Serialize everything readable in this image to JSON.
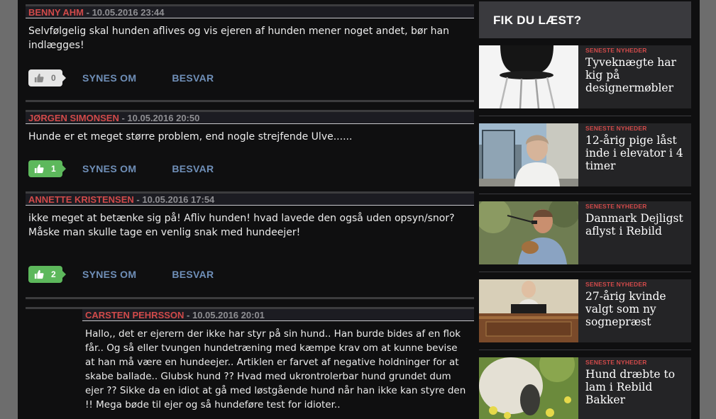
{
  "comments": [
    {
      "author": "Benny Ahm",
      "date": " - 10.05.2016 23:44",
      "text": "Selvfølgelig skal hunden aflives og vis ejeren af hunden mener noget andet, bør han indlægges!",
      "likes": "0",
      "like_label": "SYNES OM",
      "reply_label": "BESVAR"
    },
    {
      "author": "Jørgen Simonsen",
      "date": " - 10.05.2016 20:50",
      "text": "Hunde er et meget større problem, end nogle strejfende Ulve......",
      "likes": "1",
      "like_label": "SYNES OM",
      "reply_label": "BESVAR"
    },
    {
      "author": "Annette Kristensen",
      "date": " - 10.05.2016 17:54",
      "text": "ikke meget at betænke sig på! Afliv hunden! hvad lavede den også uden opsyn/snor? Måske man skulle tage en venlig snak med hundeejer!",
      "likes": "2",
      "like_label": "SYNES OM",
      "reply_label": "BESVAR"
    },
    {
      "author": "Carsten Pehrsson",
      "date": " - 10.05.2016 20:01",
      "text": "Hallo,, det er ejerern der ikke har styr på sin hund.. Han burde bides af en flok får.. Og så eller tvungen hundetræning med kæmpe krav om at kunne bevise at han må være en hundeejer.. Artiklen er farvet af negative holdninger for at skabe ballade.. Glubsk hund ?? Hvad med ukrontrolerbar hund grundet dum ejer ?? Sikke da en idiot at gå med løstgående hund når han ikke kan styre den !! Mega bøde til ejer og så hundeføre test for idioter.."
    }
  ],
  "sidebar": {
    "title": "FIK DU LÆST?",
    "news": [
      {
        "tag": "SENESTE NYHEDER",
        "headline": "Tyveknægte har kig på designermøbler",
        "image": "chair-photo"
      },
      {
        "tag": "SENESTE NYHEDER",
        "headline": "12-årig pige låst inde i elevator i 4 timer",
        "image": "woman-photo"
      },
      {
        "tag": "SENESTE NYHEDER",
        "headline": "Danmark Dejligst aflyst i Rebild",
        "image": "singer-photo"
      },
      {
        "tag": "SENESTE NYHEDER",
        "headline": "27-årig kvinde valgt som ny sognepræst",
        "image": "priest-photo"
      },
      {
        "tag": "SENESTE NYHEDER",
        "headline": "Hund dræbte to lam i Rebild Bakker",
        "image": "sheep-photo"
      }
    ]
  },
  "colors": {
    "author": "#d14a4a",
    "link": "#6f8fb8",
    "like_zero": "#e6e6e6",
    "like_active": "#5db85c"
  }
}
